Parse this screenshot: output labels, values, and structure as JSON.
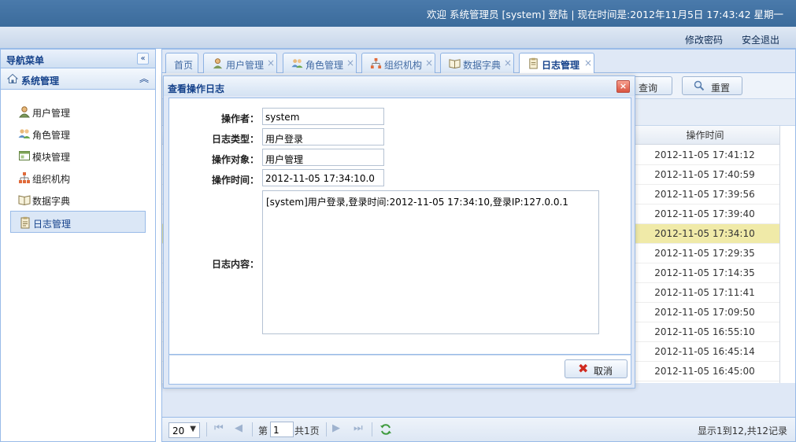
{
  "header": {
    "welcome": "欢迎 系统管理员 [system] 登陆 | 现在时间是:2012年11月5日 17:43:42 星期一",
    "change_password": "修改密码",
    "logout": "安全退出"
  },
  "nav": {
    "title": "导航菜单",
    "group": "系统管理",
    "items": [
      {
        "label": "用户管理",
        "icon": "user-icon"
      },
      {
        "label": "角色管理",
        "icon": "role-icon"
      },
      {
        "label": "模块管理",
        "icon": "module-icon"
      },
      {
        "label": "组织机构",
        "icon": "org-icon"
      },
      {
        "label": "数据字典",
        "icon": "dictionary-icon"
      },
      {
        "label": "日志管理",
        "icon": "log-icon"
      }
    ]
  },
  "tabs": [
    {
      "label": "首页"
    },
    {
      "label": "用户管理"
    },
    {
      "label": "角色管理"
    },
    {
      "label": "组织机构"
    },
    {
      "label": "数据字典"
    },
    {
      "label": "日志管理"
    }
  ],
  "toolbar": {
    "query": "查询",
    "reset": "重置"
  },
  "grid": {
    "column": "操作时间",
    "rows": [
      "2012-11-05 17:41:12",
      "2012-11-05 17:40:59",
      "2012-11-05 17:39:56",
      "2012-11-05 17:39:40",
      "2012-11-05 17:34:10",
      "2012-11-05 17:29:35",
      "2012-11-05 17:14:35",
      "2012-11-05 17:11:41",
      "2012-11-05 17:09:50",
      "2012-11-05 16:55:10",
      "2012-11-05 16:45:14",
      "2012-11-05 16:45:00"
    ],
    "selected_index": 4
  },
  "pager": {
    "page_size": "20",
    "page_prefix": "第",
    "page": "1",
    "page_total": "共1页",
    "summary": "显示1到12,共12记录"
  },
  "dialog": {
    "title": "查看操作日志",
    "fields": {
      "operator_label": "操作者：",
      "operator": "system",
      "type_label": "日志类型：",
      "type": "用户登录",
      "target_label": "操作对象：",
      "target": "用户管理",
      "time_label": "操作时间：",
      "time": "2012-11-05 17:34:10.0",
      "content_label": "日志内容：",
      "content": "[system]用户登录,登录时间:2012-11-05 17:34:10,登录IP:127.0.0.1"
    },
    "cancel": "取消"
  },
  "colors": {
    "header_blue": "#3b6b9b",
    "panel_border": "#99bbe8",
    "selected_row": "#f0eaa8",
    "title_text": "#15428b"
  }
}
